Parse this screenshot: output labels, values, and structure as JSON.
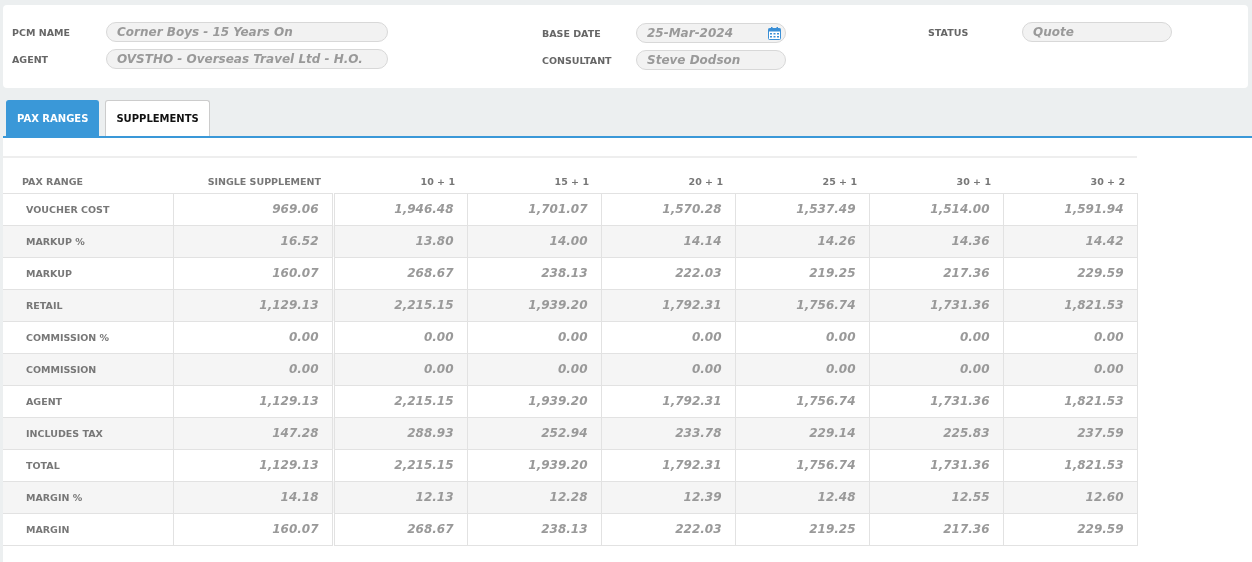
{
  "header": {
    "columns": [
      {
        "fields": [
          {
            "label": "PCM NAME",
            "value": "Corner Boys - 15 Years On",
            "kind": "text"
          },
          {
            "label": "AGENT",
            "value": "OVSTHO - Overseas Travel Ltd - H.O.",
            "kind": "text"
          }
        ]
      },
      {
        "fields": [
          {
            "label": "BASE DATE",
            "value": "25-Mar-2024",
            "kind": "date"
          },
          {
            "label": "CONSULTANT",
            "value": "Steve Dodson",
            "kind": "text"
          }
        ]
      },
      {
        "fields": [
          {
            "label": "STATUS",
            "value": "Quote",
            "kind": "text"
          }
        ]
      }
    ]
  },
  "tabs": [
    {
      "label": "PAX RANGES",
      "selected": true
    },
    {
      "label": "SUPPLEMENTS",
      "selected": false
    }
  ],
  "table": {
    "columns": [
      "PAX RANGE",
      "SINGLE SUPPLEMENT",
      "10 + 1",
      "15 + 1",
      "20 + 1",
      "25 + 1",
      "30 + 1",
      "30 + 2"
    ],
    "rows": [
      {
        "cells": [
          "VOUCHER COST",
          "969.06",
          "1,946.48",
          "1,701.07",
          "1,570.28",
          "1,537.49",
          "1,514.00",
          "1,591.94"
        ]
      },
      {
        "cells": [
          "MARKUP %",
          "16.52",
          "13.80",
          "14.00",
          "14.14",
          "14.26",
          "14.36",
          "14.42"
        ]
      },
      {
        "cells": [
          "MARKUP",
          "160.07",
          "268.67",
          "238.13",
          "222.03",
          "219.25",
          "217.36",
          "229.59"
        ]
      },
      {
        "cells": [
          "RETAIL",
          "1,129.13",
          "2,215.15",
          "1,939.20",
          "1,792.31",
          "1,756.74",
          "1,731.36",
          "1,821.53"
        ]
      },
      {
        "cells": [
          "COMMISSION %",
          "0.00",
          "0.00",
          "0.00",
          "0.00",
          "0.00",
          "0.00",
          "0.00"
        ]
      },
      {
        "cells": [
          "COMMISSION",
          "0.00",
          "0.00",
          "0.00",
          "0.00",
          "0.00",
          "0.00",
          "0.00"
        ]
      },
      {
        "cells": [
          "AGENT",
          "1,129.13",
          "2,215.15",
          "1,939.20",
          "1,792.31",
          "1,756.74",
          "1,731.36",
          "1,821.53"
        ]
      },
      {
        "cells": [
          "INCLUDES TAX",
          "147.28",
          "288.93",
          "252.94",
          "233.78",
          "229.14",
          "225.83",
          "237.59"
        ]
      },
      {
        "cells": [
          "TOTAL",
          "1,129.13",
          "2,215.15",
          "1,939.20",
          "1,792.31",
          "1,756.74",
          "1,731.36",
          "1,821.53"
        ]
      },
      {
        "cells": [
          "MARGIN %",
          "14.18",
          "12.13",
          "12.28",
          "12.39",
          "12.48",
          "12.55",
          "12.60"
        ]
      },
      {
        "cells": [
          "MARGIN",
          "160.07",
          "268.67",
          "238.13",
          "222.03",
          "219.25",
          "217.36",
          "229.59"
        ]
      }
    ]
  }
}
